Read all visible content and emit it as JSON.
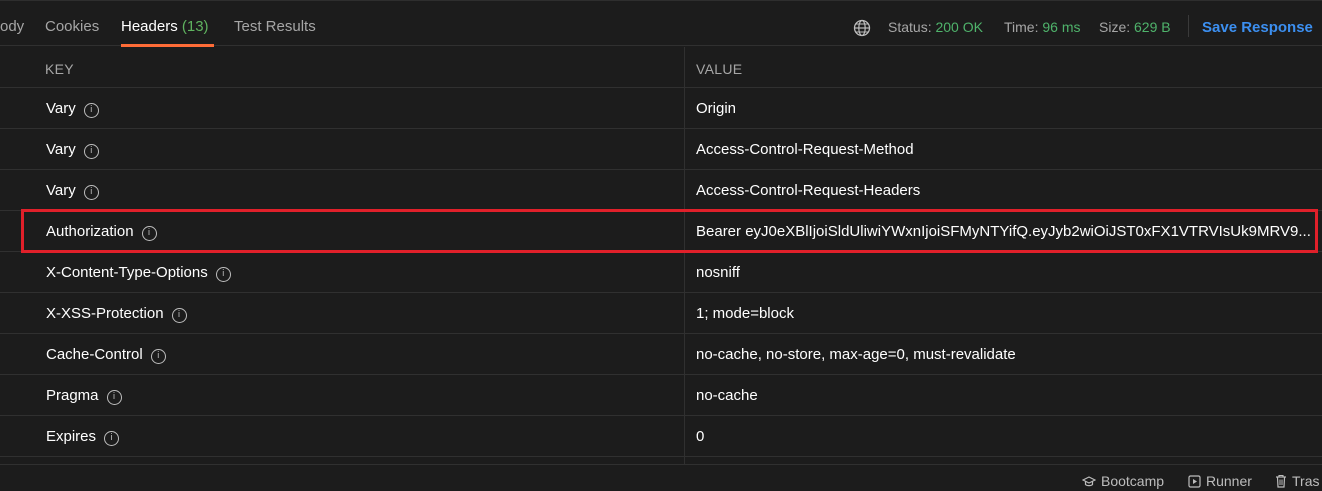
{
  "tabs": [
    {
      "label": "ody"
    },
    {
      "label": "Cookies"
    },
    {
      "label": "Headers",
      "count": "(13)"
    },
    {
      "label": "Test Results"
    }
  ],
  "status_bar": {
    "status_label": "Status:",
    "status_value": "200 OK",
    "time_label": "Time:",
    "time_value": "96 ms",
    "size_label": "Size:",
    "size_value": "629 B",
    "save_label": "Save Response"
  },
  "table": {
    "columns": [
      "KEY",
      "VALUE"
    ],
    "rows": [
      {
        "key": "Vary",
        "value": "Origin"
      },
      {
        "key": "Vary",
        "value": "Access-Control-Request-Method"
      },
      {
        "key": "Vary",
        "value": "Access-Control-Request-Headers"
      },
      {
        "key": "Authorization",
        "value": "Bearer eyJ0eXBlIjoiSldUliwiYWxnIjoiSFMyNTYifQ.eyJyb2wiOiJST0xFX1VTRVIsUk9MRV9..."
      },
      {
        "key": "X-Content-Type-Options",
        "value": "nosniff"
      },
      {
        "key": "X-XSS-Protection",
        "value": "1; mode=block"
      },
      {
        "key": "Cache-Control",
        "value": "no-cache, no-store, max-age=0, must-revalidate"
      },
      {
        "key": "Pragma",
        "value": "no-cache"
      },
      {
        "key": "Expires",
        "value": "0"
      }
    ]
  },
  "footer": {
    "bootcamp": "Bootcamp",
    "runner": "Runner",
    "trash": "Tras"
  },
  "colors": {
    "accent": "#ff6c37",
    "success": "#4fb36b",
    "link": "#3c8ff0",
    "highlight": "#e0202a"
  },
  "icons": [
    "globe-icon",
    "info-icon",
    "bootcamp-icon",
    "runner-icon",
    "trash-icon"
  ]
}
